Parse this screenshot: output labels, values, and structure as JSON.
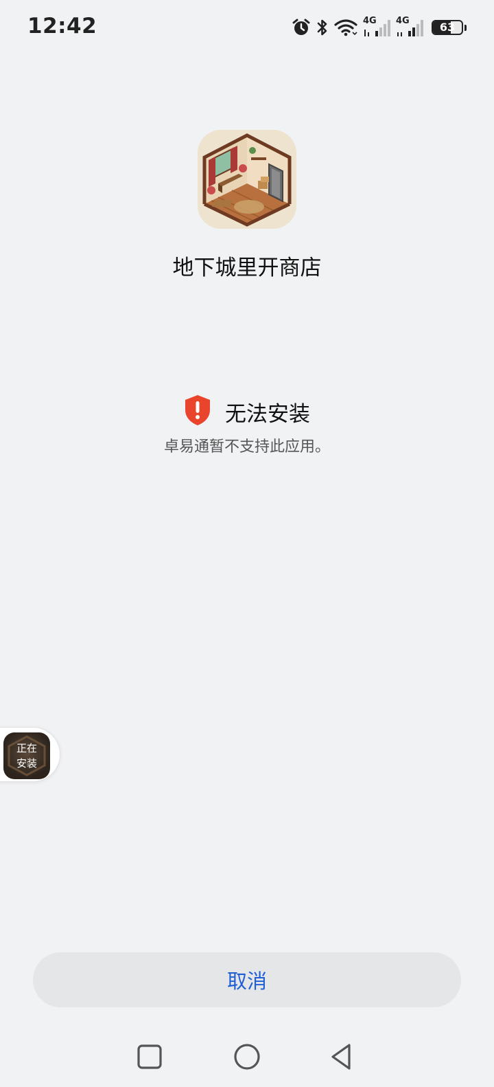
{
  "status_bar": {
    "time": "12:42",
    "icons": [
      "alarm-icon",
      "bluetooth-icon",
      "wifi-icon",
      "signal-4g-icon",
      "signal-4g-icon"
    ],
    "network_label_1": "4G",
    "network_label_2": "4G",
    "battery_level": "63",
    "battery_fraction": 0.63
  },
  "app": {
    "name": "地下城里开商店",
    "icon": "room-game-icon"
  },
  "error": {
    "icon": "shield-alert-icon",
    "title": "无法安装",
    "message": "卓易通暂不支持此应用。",
    "color": "#e8452c"
  },
  "floating": {
    "line1": "正在",
    "line2": "安装"
  },
  "actions": {
    "cancel_label": "取消",
    "accent": "#1f5fd6"
  },
  "nav_bar": {
    "icons": [
      "recents-square-icon",
      "home-circle-icon",
      "back-triangle-icon"
    ]
  }
}
